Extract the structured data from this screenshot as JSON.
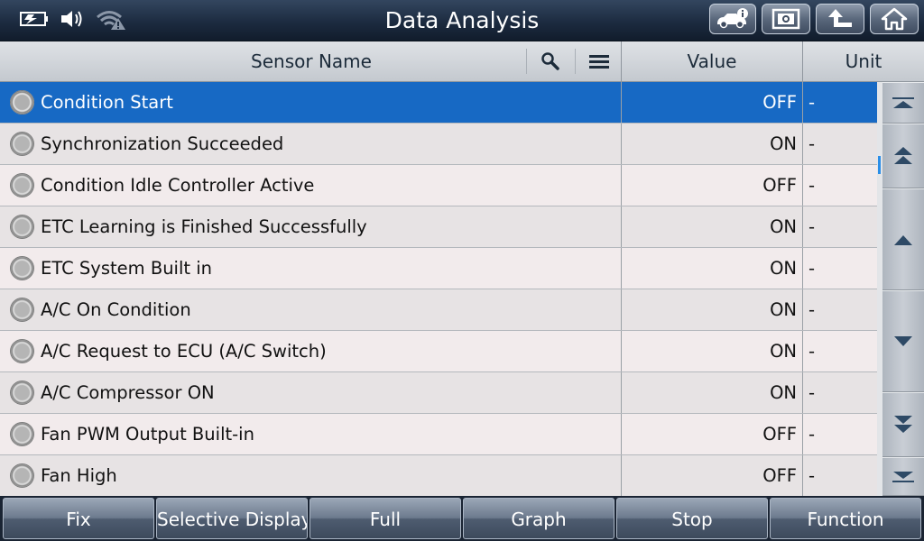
{
  "header": {
    "title": "Data Analysis",
    "status_icons": [
      "battery-icon",
      "volume-icon",
      "wifi-warning-icon"
    ],
    "buttons": [
      "car-info-icon",
      "screenshot-icon",
      "back-up-icon",
      "home-icon"
    ]
  },
  "columns": {
    "sensor_name": "Sensor Name",
    "value": "Value",
    "unit": "Unit"
  },
  "rows": [
    {
      "name": "Condition Start",
      "value": "OFF",
      "unit": "-",
      "selected": true
    },
    {
      "name": "Synchronization Succeeded",
      "value": "ON",
      "unit": "-"
    },
    {
      "name": "Condition Idle Controller Active",
      "value": "OFF",
      "unit": "-"
    },
    {
      "name": "ETC Learning is Finished Successfully",
      "value": "ON",
      "unit": "-"
    },
    {
      "name": "ETC System Built in",
      "value": "ON",
      "unit": "-"
    },
    {
      "name": "A/C On Condition",
      "value": "ON",
      "unit": "-"
    },
    {
      "name": "A/C Request to ECU (A/C Switch)",
      "value": "ON",
      "unit": "-"
    },
    {
      "name": "A/C Compressor ON",
      "value": "ON",
      "unit": "-"
    },
    {
      "name": "Fan PWM Output Built-in",
      "value": "OFF",
      "unit": "-"
    },
    {
      "name": "Fan High",
      "value": "OFF",
      "unit": "-"
    }
  ],
  "footer": {
    "fix": "Fix",
    "selective_display": "Selective Display",
    "full": "Full",
    "graph": "Graph",
    "stop": "Stop",
    "function": "Function"
  },
  "colors": {
    "selected_row": "#1769c4",
    "scroll_thumb": "#2a8ee8",
    "title_bar": "#1c2b40"
  }
}
